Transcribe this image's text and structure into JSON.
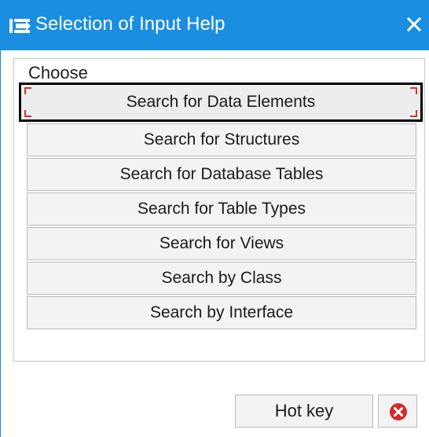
{
  "window": {
    "title": "Selection of Input Help",
    "title_icon": "selection-arrow-icon",
    "close_icon": "close-icon",
    "titlebar_color": "#1a8ee0"
  },
  "panel": {
    "label": "Choose",
    "options": [
      {
        "label": "Search for Data Elements",
        "focused": true
      },
      {
        "label": "Search for Structures",
        "focused": false
      },
      {
        "label": "Search for Database Tables",
        "focused": false
      },
      {
        "label": "Search for Table Types",
        "focused": false
      },
      {
        "label": "Search for Views",
        "focused": false
      },
      {
        "label": "Search by Class",
        "focused": false
      },
      {
        "label": "Search by Interface",
        "focused": false
      }
    ]
  },
  "footer": {
    "hotkey_label": "Hot key",
    "cancel_icon": "cancel-x-circle-icon",
    "cancel_color": "#d42a2a"
  }
}
